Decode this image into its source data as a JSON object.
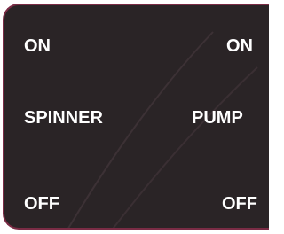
{
  "panel": {
    "left_switch": {
      "on_label": "ON",
      "name_label": "SPINNER",
      "off_label": "OFF"
    },
    "right_switch": {
      "on_label": "ON",
      "name_label": "PUMP",
      "off_label": "OFF"
    }
  },
  "colors": {
    "panel_background": "#2a2426",
    "panel_border": "#7a2c45",
    "label_text": "#ffffff"
  }
}
